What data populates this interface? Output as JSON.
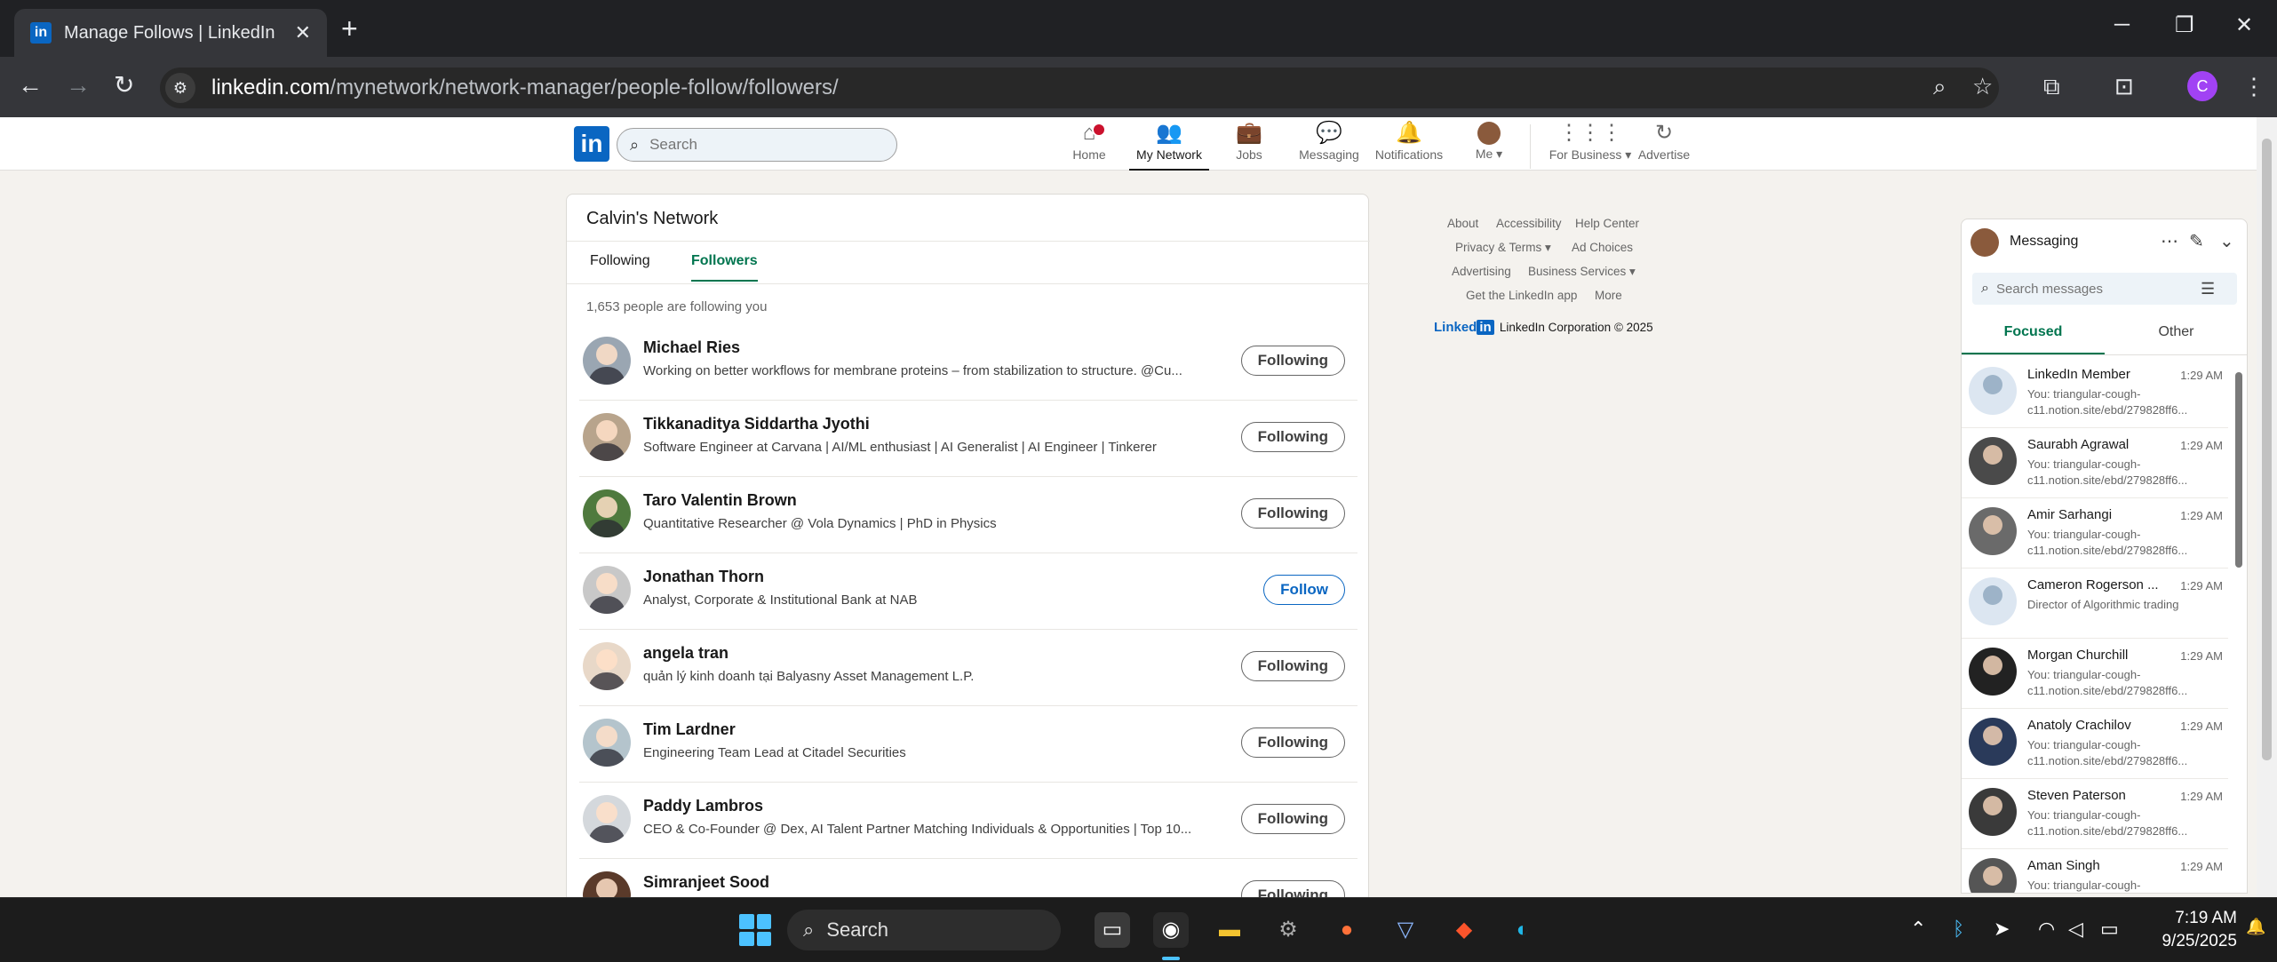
{
  "browser": {
    "tab_title": "Manage Follows | LinkedIn",
    "favicon": "in",
    "url_host": "linkedin.com",
    "url_path": "/mynetwork/network-manager/people-follow/followers/",
    "profile_initial": "C"
  },
  "linkedin": {
    "logo": "in",
    "search_placeholder": "Search",
    "nav": [
      {
        "label": "Home",
        "icon": "home-icon"
      },
      {
        "label": "My Network",
        "icon": "people-icon"
      },
      {
        "label": "Jobs",
        "icon": "briefcase-icon"
      },
      {
        "label": "Messaging",
        "icon": "chat-icon"
      },
      {
        "label": "Notifications",
        "icon": "bell-icon"
      },
      {
        "label": "Me ▾",
        "icon": "avatar"
      },
      {
        "label": "For Business ▾",
        "icon": "grid-icon"
      },
      {
        "label": "Advertise",
        "icon": "advertise-icon"
      }
    ]
  },
  "network": {
    "title": "Calvin's Network",
    "tabs": [
      "Following",
      "Followers"
    ],
    "active_tab": "Followers",
    "count_text": "1,653 people are following you",
    "people": [
      {
        "name": "Michael Ries",
        "headline": "Working on better workflows for membrane proteins – from stabilization to structure. @Cu...",
        "button": "Following"
      },
      {
        "name": "Tikkanaditya Siddartha Jyothi",
        "headline": "Software Engineer at Carvana | AI/ML enthusiast | AI Generalist | AI Engineer | Tinkerer",
        "button": "Following"
      },
      {
        "name": "Taro Valentin Brown",
        "headline": "Quantitative Researcher @ Vola Dynamics | PhD in Physics",
        "button": "Following"
      },
      {
        "name": "Jonathan Thorn",
        "headline": "Analyst, Corporate & Institutional Bank at NAB",
        "button": "Follow"
      },
      {
        "name": "angela tran",
        "headline": "quản lý kinh doanh tại Balyasny Asset Management L.P.",
        "button": "Following"
      },
      {
        "name": "Tim Lardner",
        "headline": "Engineering Team Lead at Citadel Securities",
        "button": "Following"
      },
      {
        "name": "Paddy Lambros",
        "headline": "CEO & Co-Founder @ Dex, AI Talent Partner Matching Individuals & Opportunities | Top 10...",
        "button": "Following"
      },
      {
        "name": "Simranjeet Sood",
        "headline": "",
        "button": "Following"
      }
    ]
  },
  "footer": {
    "links": [
      "About",
      "Accessibility",
      "Help Center",
      "Privacy & Terms ▾",
      "Ad Choices",
      "Advertising",
      "Business Services ▾",
      "Get the LinkedIn app",
      "More"
    ],
    "brand": "Linked",
    "brand_in": "in",
    "copyright": "LinkedIn Corporation © 2025"
  },
  "messaging": {
    "title": "Messaging",
    "search_placeholder": "Search messages",
    "tabs": [
      "Focused",
      "Other"
    ],
    "conversations": [
      {
        "name": "LinkedIn Member",
        "time": "1:29 AM",
        "preview": "You: triangular-cough-c11.notion.site/ebd/279828ff6...",
        "ghost": true
      },
      {
        "name": "Saurabh Agrawal",
        "time": "1:29 AM",
        "preview": "You: triangular-cough-c11.notion.site/ebd/279828ff6...",
        "ghost": false
      },
      {
        "name": "Amir Sarhangi",
        "time": "1:29 AM",
        "preview": "You: triangular-cough-c11.notion.site/ebd/279828ff6...",
        "ghost": false
      },
      {
        "name": "Cameron Rogerson ...",
        "time": "1:29 AM",
        "preview": "Director of Algorithmic trading",
        "ghost": true
      },
      {
        "name": "Morgan Churchill",
        "time": "1:29 AM",
        "preview": "You: triangular-cough-c11.notion.site/ebd/279828ff6...",
        "ghost": false
      },
      {
        "name": "Anatoly Crachilov",
        "time": "1:29 AM",
        "preview": "You: triangular-cough-c11.notion.site/ebd/279828ff6...",
        "ghost": false
      },
      {
        "name": "Steven Paterson",
        "time": "1:29 AM",
        "preview": "You: triangular-cough-c11.notion.site/ebd/279828ff6...",
        "ghost": false
      },
      {
        "name": "Aman Singh",
        "time": "1:29 AM",
        "preview": "You: triangular-cough-",
        "ghost": false
      }
    ]
  },
  "taskbar": {
    "search_label": "Search",
    "time": "7:19 AM",
    "date": "9/25/2025"
  },
  "colors": {
    "linkedin_blue": "#0a66c2",
    "linkedin_green": "#01754f",
    "notification_red": "#cb112d",
    "page_bg": "#f4f2ee"
  }
}
